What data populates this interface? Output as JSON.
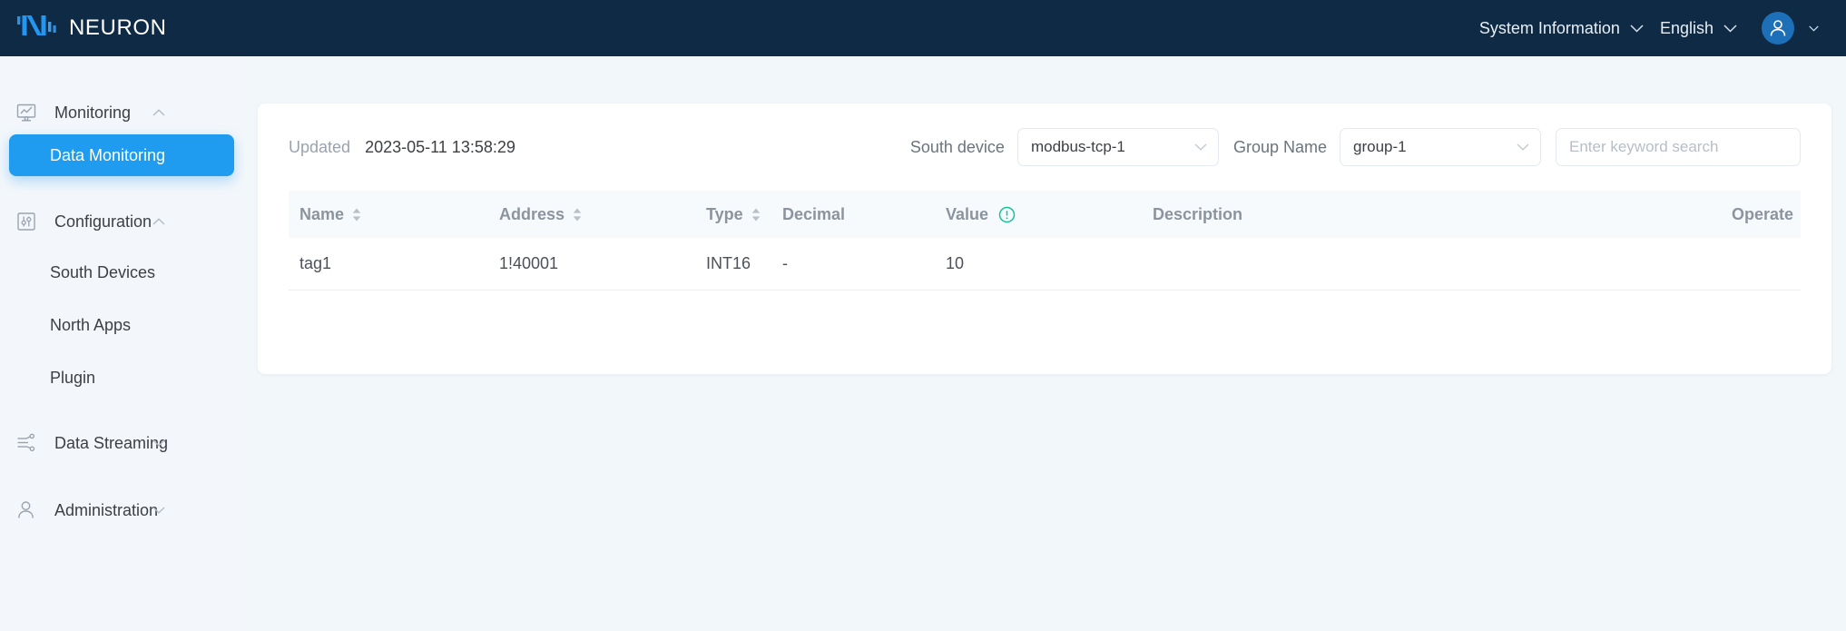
{
  "header": {
    "brand": "NEURON",
    "logo_icon": "neuron-logo-icon",
    "system_information": "System Information",
    "language": "English",
    "avatar_icon": "user-avatar-icon",
    "chevron_icon": "chevron-down-icon",
    "colors": {
      "background": "#0e2a45",
      "logo_blue": "#2196f3",
      "avatar_bg": "#1d6fb8"
    }
  },
  "sidebar": {
    "background": "#f3f7fb",
    "active_color": "#1f9cf0",
    "items": [
      {
        "label": "Monitoring",
        "icon": "monitor-chart-icon",
        "type": "group",
        "expanded": true,
        "chevron": "chevron-up-icon"
      },
      {
        "label": "Data Monitoring",
        "icon": "",
        "type": "sub",
        "active": true
      },
      {
        "label": "Configuration",
        "icon": "sliders-icon",
        "type": "group",
        "expanded": true,
        "chevron": "chevron-up-icon"
      },
      {
        "label": "South Devices",
        "icon": "",
        "type": "sub",
        "active": false
      },
      {
        "label": "North Apps",
        "icon": "",
        "type": "sub",
        "active": false
      },
      {
        "label": "Plugin",
        "icon": "",
        "type": "sub",
        "active": false
      },
      {
        "label": "Data Streaming",
        "icon": "data-flow-icon",
        "type": "group",
        "expanded": false,
        "chevron": "chevron-down-icon"
      },
      {
        "label": "Administration",
        "icon": "person-icon",
        "type": "group",
        "expanded": false,
        "chevron": "chevron-down-icon"
      }
    ]
  },
  "filters": {
    "updated_label": "Updated",
    "updated_value": "2023-05-11 13:58:29",
    "south_device_label": "South device",
    "south_device_value": "modbus-tcp-1",
    "group_name_label": "Group Name",
    "group_name_value": "group-1",
    "search_placeholder": "Enter keyword search",
    "search_value": ""
  },
  "table": {
    "columns": [
      {
        "key": "name",
        "label": "Name",
        "sortable": true
      },
      {
        "key": "address",
        "label": "Address",
        "sortable": true
      },
      {
        "key": "type",
        "label": "Type",
        "sortable": true
      },
      {
        "key": "decimal",
        "label": "Decimal",
        "sortable": false
      },
      {
        "key": "value",
        "label": "Value",
        "sortable": false,
        "info_icon": "info-circle-icon"
      },
      {
        "key": "description",
        "label": "Description",
        "sortable": false
      },
      {
        "key": "operate",
        "label": "Operate",
        "sortable": false
      }
    ],
    "rows": [
      {
        "name": "tag1",
        "address": "1!40001",
        "type": "INT16",
        "decimal": "-",
        "value": "10",
        "description": "",
        "operate": ""
      }
    ],
    "info_icon_color": "#13c296"
  }
}
